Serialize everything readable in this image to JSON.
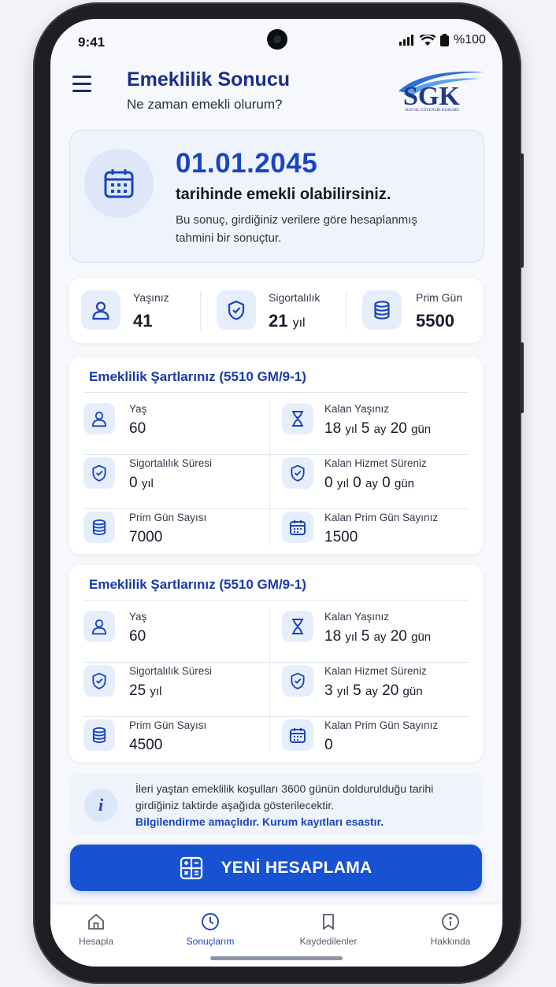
{
  "status_bar": {
    "time": "9:41",
    "battery": "%100"
  },
  "header": {
    "title": "Emeklilik Sonucu",
    "subtitle": "Ne zaman emekli olurum?",
    "logo_text": "SGK",
    "logo_subtext": "SOSYAL GÜVENLİK KURUMU"
  },
  "result": {
    "date": "01.01.2045",
    "headline": "tarihinde emekli olabilirsiniz.",
    "note": "Bu sonuç, girdiğiniz verilere göre hesaplanmış tahmini bir sonuçtur."
  },
  "summary": [
    {
      "label": "Yaşınız",
      "value": "41",
      "unit": ""
    },
    {
      "label": "Sigortalılık",
      "value": "21",
      "unit": "yıl"
    },
    {
      "label": "Prim Gün",
      "value": "5500",
      "unit": ""
    }
  ],
  "conditions": [
    {
      "title": "Emeklilik Şartlarınız (5510 GM/9-1)",
      "age_label": "Yaş",
      "age_value": "60",
      "remaining_age_label": "Kalan Yaşınız",
      "remaining_age": {
        "years": "18",
        "months": "5",
        "days": "20"
      },
      "insurance_label": "Sigortalılık Süresi",
      "insurance_value": "0",
      "remaining_service_label": "Kalan Hizmet Süreniz",
      "remaining_service": {
        "years": "0",
        "months": "0",
        "days": "0"
      },
      "premium_label": "Prim Gün Sayısı",
      "premium_value": "7000",
      "remaining_premium_label": "Kalan Prim Gün Sayınız",
      "remaining_premium_value": "1500"
    },
    {
      "title": "Emeklilik Şartlarınız (5510 GM/9-1)",
      "age_label": "Yaş",
      "age_value": "60",
      "remaining_age_label": "Kalan Yaşınız",
      "remaining_age": {
        "years": "18",
        "months": "5",
        "days": "20"
      },
      "insurance_label": "Sigortalılık Süresi",
      "insurance_value": "25",
      "remaining_service_label": "Kalan Hizmet Süreniz",
      "remaining_service": {
        "years": "3",
        "months": "5",
        "days": "20"
      },
      "premium_label": "Prim Gün Sayısı",
      "premium_value": "4500",
      "remaining_premium_label": "Kalan Prim Gün Sayınız",
      "remaining_premium_value": "0"
    }
  ],
  "units": {
    "year": "yıl",
    "month": "ay",
    "day": "gün"
  },
  "info": {
    "line1": "İleri yaştan emeklilik koşulları  3600 günün doldurulduğu tarihi girdiğiniz taktirde aşağıda gösterilecektir.",
    "line2": "Bilgilendirme amaçlıdır. Kurum kayıtları esastır."
  },
  "cta": {
    "label": "YENİ HESAPLAMA"
  },
  "nav": [
    {
      "label": "Hesapla",
      "icon": "home-icon"
    },
    {
      "label": "Sonuçlarım",
      "icon": "clock-icon"
    },
    {
      "label": "Kaydedilenler",
      "icon": "bookmark-icon"
    },
    {
      "label": "Hakkında",
      "icon": "info-icon"
    }
  ],
  "colors": {
    "primary": "#1652d1",
    "title": "#1a2d8c",
    "accent_bg": "#eef3fc"
  }
}
